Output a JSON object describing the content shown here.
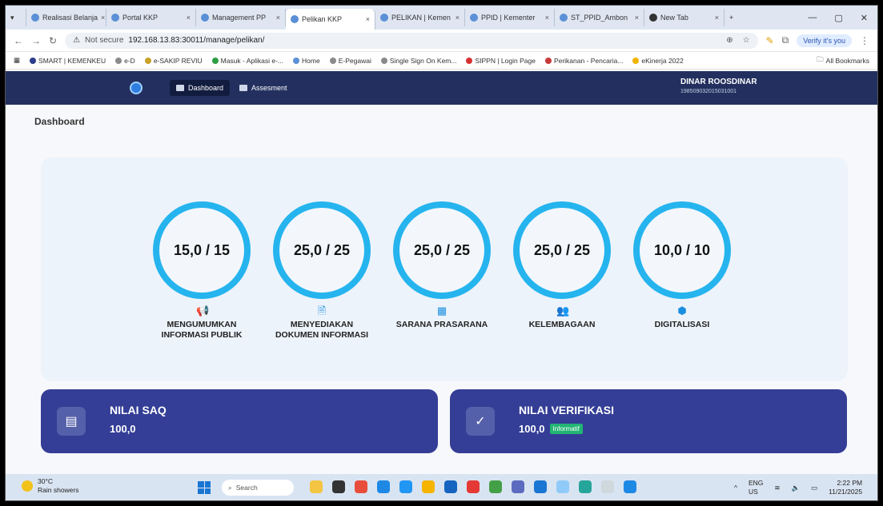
{
  "browser": {
    "tabs": [
      {
        "label": "Realisasi Belanja",
        "active": false
      },
      {
        "label": "Portal KKP",
        "active": false
      },
      {
        "label": "Management PP",
        "active": false
      },
      {
        "label": "Pelikan KKP",
        "active": true
      },
      {
        "label": "PELIKAN | Kemen",
        "active": false
      },
      {
        "label": "PPID | Kementer",
        "active": false
      },
      {
        "label": "ST_PPID_Ambon",
        "active": false
      },
      {
        "label": "New Tab",
        "active": false
      }
    ],
    "not_secure": "Not secure",
    "url": "192.168.13.83:30011/manage/pelikan/",
    "verify": "Verify it's you",
    "bookmarks": [
      {
        "label": "SMART | KEMENKEU",
        "color": "#2c3e8c"
      },
      {
        "label": "e-D",
        "color": "#8a8a8a"
      },
      {
        "label": "e-SAKIP REVIU",
        "color": "#c9a227"
      },
      {
        "label": "Masuk - Aplikasi e-...",
        "color": "#2e9e44"
      },
      {
        "label": "Home",
        "color": "#5b8fd6"
      },
      {
        "label": "E-Pegawai",
        "color": "#8a8a8a"
      },
      {
        "label": "Single Sign On Kem...",
        "color": "#8a8a8a"
      },
      {
        "label": "SIPPN | Login Page",
        "color": "#d83030"
      },
      {
        "label": "Perikanan - Pencaria...",
        "color": "#c83a3a"
      },
      {
        "label": "eKinerja 2022",
        "color": "#f0b400"
      }
    ],
    "all_bookmarks": "All Bookmarks"
  },
  "header": {
    "nav_dashboard": "Dashboard",
    "nav_assessment": "Assesment",
    "user_name": "DINAR ROOSDINAR",
    "user_nip": "198509032015031001"
  },
  "page": {
    "breadcrumb": "Dashboard"
  },
  "scores": [
    {
      "value": "15,0 / 15",
      "label": "MENGUMUMKAN INFORMASI PUBLIK",
      "icon": "megaphone-icon"
    },
    {
      "value": "25,0 / 25",
      "label": "MENYEDIAKAN DOKUMEN INFORMASI",
      "icon": "document-icon"
    },
    {
      "value": "25,0 / 25",
      "label": "SARANA PRASARANA",
      "icon": "building-icon"
    },
    {
      "value": "25,0 / 25",
      "label": "KELEMBAGAAN",
      "icon": "users-icon"
    },
    {
      "value": "10,0 / 10",
      "label": "DIGITALISASI",
      "icon": "chip-icon"
    }
  ],
  "cards": {
    "saq": {
      "title": "NILAI SAQ",
      "value": "100,0"
    },
    "verifikasi": {
      "title": "NILAI VERIFIKASI",
      "value": "100,0",
      "badge": "Informatif"
    }
  },
  "taskbar": {
    "temp": "30°C",
    "weather": "Rain showers",
    "search": "Search",
    "lang": "ENG",
    "region": "US",
    "time": "2:22 PM",
    "date": "11/21/2025"
  },
  "colors": {
    "header": "#23305f",
    "ring": "#25b4ee",
    "card": "#343e96",
    "badge": "#22b573"
  }
}
